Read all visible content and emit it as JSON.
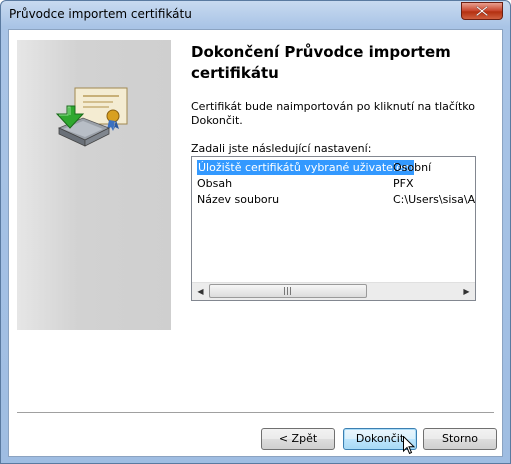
{
  "window": {
    "title": "Průvodce importem certifikátu"
  },
  "wizard": {
    "heading": "Dokončení Průvodce importem certifikátu",
    "intro": "Certifikát bude naimportován po kliknutí na tlačítko Dokončit.",
    "settings_label": "Zadali jste následující nastavení:"
  },
  "settings": [
    {
      "name": "Úložiště certifikátů vybrané uživatelem",
      "value": "Osobní",
      "selected": true
    },
    {
      "name": "Obsah",
      "value": "PFX"
    },
    {
      "name": "Název souboru",
      "value": "C:\\Users\\sisa\\Ap"
    }
  ],
  "buttons": {
    "back": "< Zpět",
    "finish": "Dokončit",
    "cancel": "Storno"
  },
  "icons": {
    "close": "close-icon",
    "wizard": "certificate-import-icon",
    "cursor": "mouse-cursor-icon"
  },
  "colors": {
    "selection": "#3399ff",
    "close": "#c7432a"
  }
}
